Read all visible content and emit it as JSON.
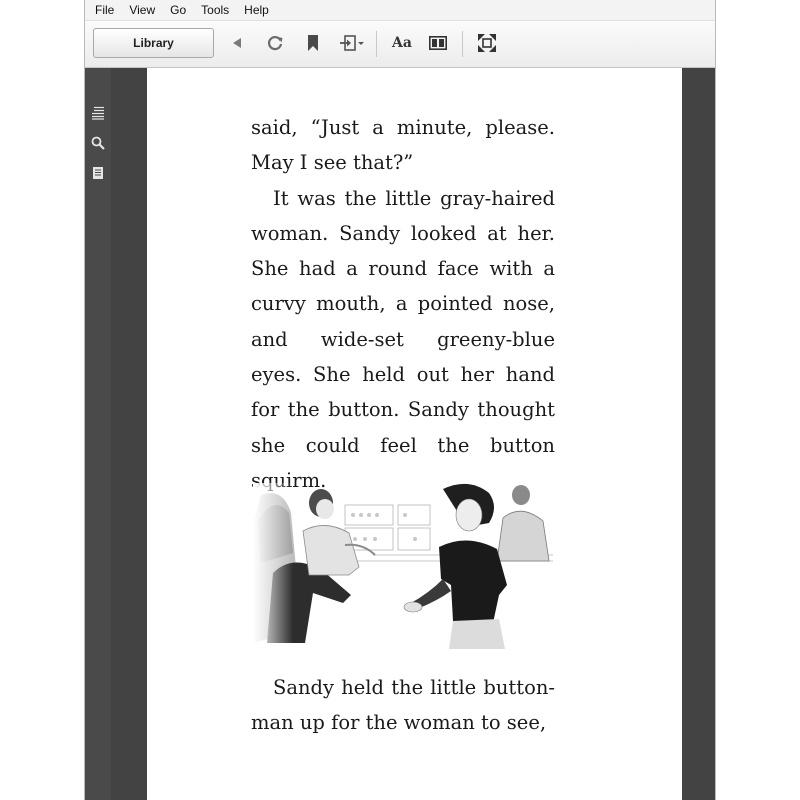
{
  "menu": [
    "File",
    "View",
    "Go",
    "Tools",
    "Help"
  ],
  "toolbar": {
    "library_label": "Library",
    "font_label": "Aa",
    "icons": [
      "back-icon",
      "refresh-icon",
      "bookmark-icon",
      "goto-icon",
      "font-size-icon",
      "layout-icon",
      "fullscreen-icon"
    ]
  },
  "sidebar": {
    "icons": [
      "toc-icon",
      "search-icon",
      "notes-icon"
    ]
  },
  "page": {
    "paragraphs": [
      "said, “Just a minute, please. May I see that?”",
      "It was the little gray-haired woman. Sandy looked at her. She had a round face with a curvy mouth, a pointed nose, and wide-set greeny-blue eyes. She held out her hand for the button. Sandy thought she could feel the button squirm."
    ],
    "paragraphs_after": [
      "Sandy held the little button-man up for the woman to see,"
    ],
    "illustration": "pencil-sketch-illustration"
  },
  "colors": {
    "chrome_dark": "#4a4a4a",
    "gutter": "#434343",
    "toolbar_bg": "#ececec"
  }
}
